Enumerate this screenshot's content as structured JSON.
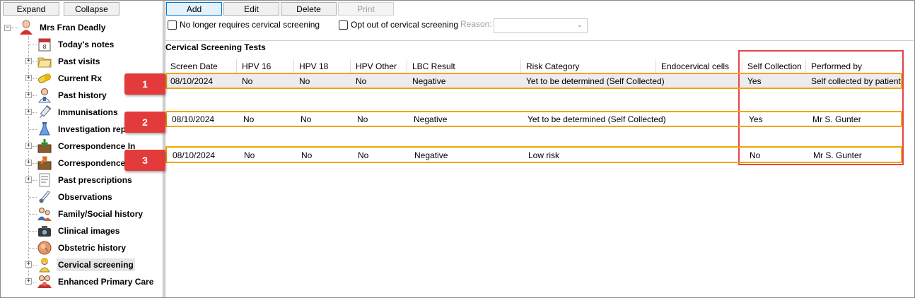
{
  "toolbar_left": {
    "expand": "Expand",
    "collapse": "Collapse"
  },
  "tree": {
    "root": "Mrs Fran Deadly",
    "items": [
      {
        "label": "Today's notes",
        "icon": "calendar-icon",
        "expandable": false
      },
      {
        "label": "Past visits",
        "icon": "folder-icon",
        "expandable": true
      },
      {
        "label": "Current Rx",
        "icon": "pill-icon",
        "expandable": true
      },
      {
        "label": "Past history",
        "icon": "doctor-icon",
        "expandable": true
      },
      {
        "label": "Immunisations",
        "icon": "syringe-icon",
        "expandable": true
      },
      {
        "label": "Investigation reports",
        "icon": "flask-icon",
        "expandable": false
      },
      {
        "label": "Correspondence In",
        "icon": "inbox-icon",
        "expandable": true
      },
      {
        "label": "Correspondence Out",
        "icon": "outbox-icon",
        "expandable": true
      },
      {
        "label": "Past prescriptions",
        "icon": "prescription-icon",
        "expandable": true
      },
      {
        "label": "Observations",
        "icon": "thermometer-icon",
        "expandable": false
      },
      {
        "label": "Family/Social history",
        "icon": "family-icon",
        "expandable": false
      },
      {
        "label": "Clinical images",
        "icon": "camera-icon",
        "expandable": false
      },
      {
        "label": "Obstetric history",
        "icon": "fetus-icon",
        "expandable": false
      },
      {
        "label": "Cervical screening",
        "icon": "woman-icon",
        "expandable": true,
        "selected": true
      },
      {
        "label": "Enhanced Primary Care",
        "icon": "team-icon",
        "expandable": true
      }
    ]
  },
  "actions": {
    "add": "Add",
    "edit": "Edit",
    "delete": "Delete",
    "print": "Print"
  },
  "options": {
    "no_longer_requires": "No longer requires cervical screening",
    "opt_out": "Opt out of cervical screening",
    "reason_label": "Reason:",
    "reason_value": ""
  },
  "section_title": "Cervical Screening Tests",
  "table": {
    "columns": [
      "Screen Date",
      "HPV 16",
      "HPV 18",
      "HPV Other",
      "LBC Result",
      "Risk Category",
      "Endocervical cells",
      "Self Collection",
      "Performed by"
    ],
    "rows": [
      [
        "08/10/2024",
        "No",
        "No",
        "No",
        "Negative",
        "Yet to be determined (Self Collected)",
        "",
        "Yes",
        "Self collected by patient"
      ],
      [
        "08/10/2024",
        "No",
        "No",
        "No",
        "Negative",
        "Yet to be determined (Self Collected)",
        "",
        "Yes",
        "Mr S. Gunter"
      ],
      [
        "08/10/2024",
        "No",
        "No",
        "No",
        "Negative",
        "Low risk",
        "",
        "No",
        "Mr S. Gunter"
      ]
    ]
  },
  "badges": [
    "1",
    "2",
    "3"
  ],
  "colors": {
    "badge": "#e33b3b",
    "row_highlight": "#f0a500",
    "column_highlight": "#e84545"
  }
}
